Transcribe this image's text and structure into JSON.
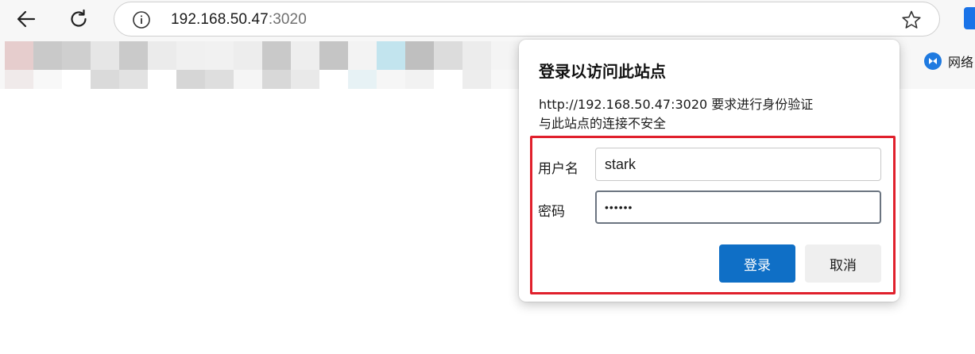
{
  "browser": {
    "address": {
      "host": "192.168.50.47",
      "port": ":3020"
    },
    "favorites": {
      "visible_label": "网络"
    }
  },
  "dialog": {
    "title": "登录以访问此站点",
    "message_line1": "http://192.168.50.47:3020 要求进行身份验证",
    "message_line2": "与此站点的连接不安全",
    "username_label": "用户名",
    "username_value": "stark",
    "password_label": "密码",
    "password_value": "••••••",
    "login_button": "登录",
    "cancel_button": "取消"
  },
  "colors": {
    "highlight": "#e0202c",
    "primary_button": "#0f6fc6",
    "toolbar_bg": "#f7f7f7"
  },
  "icons": [
    "back-arrow-icon",
    "reload-icon",
    "info-icon",
    "star-icon",
    "favorites-logo-icon"
  ]
}
